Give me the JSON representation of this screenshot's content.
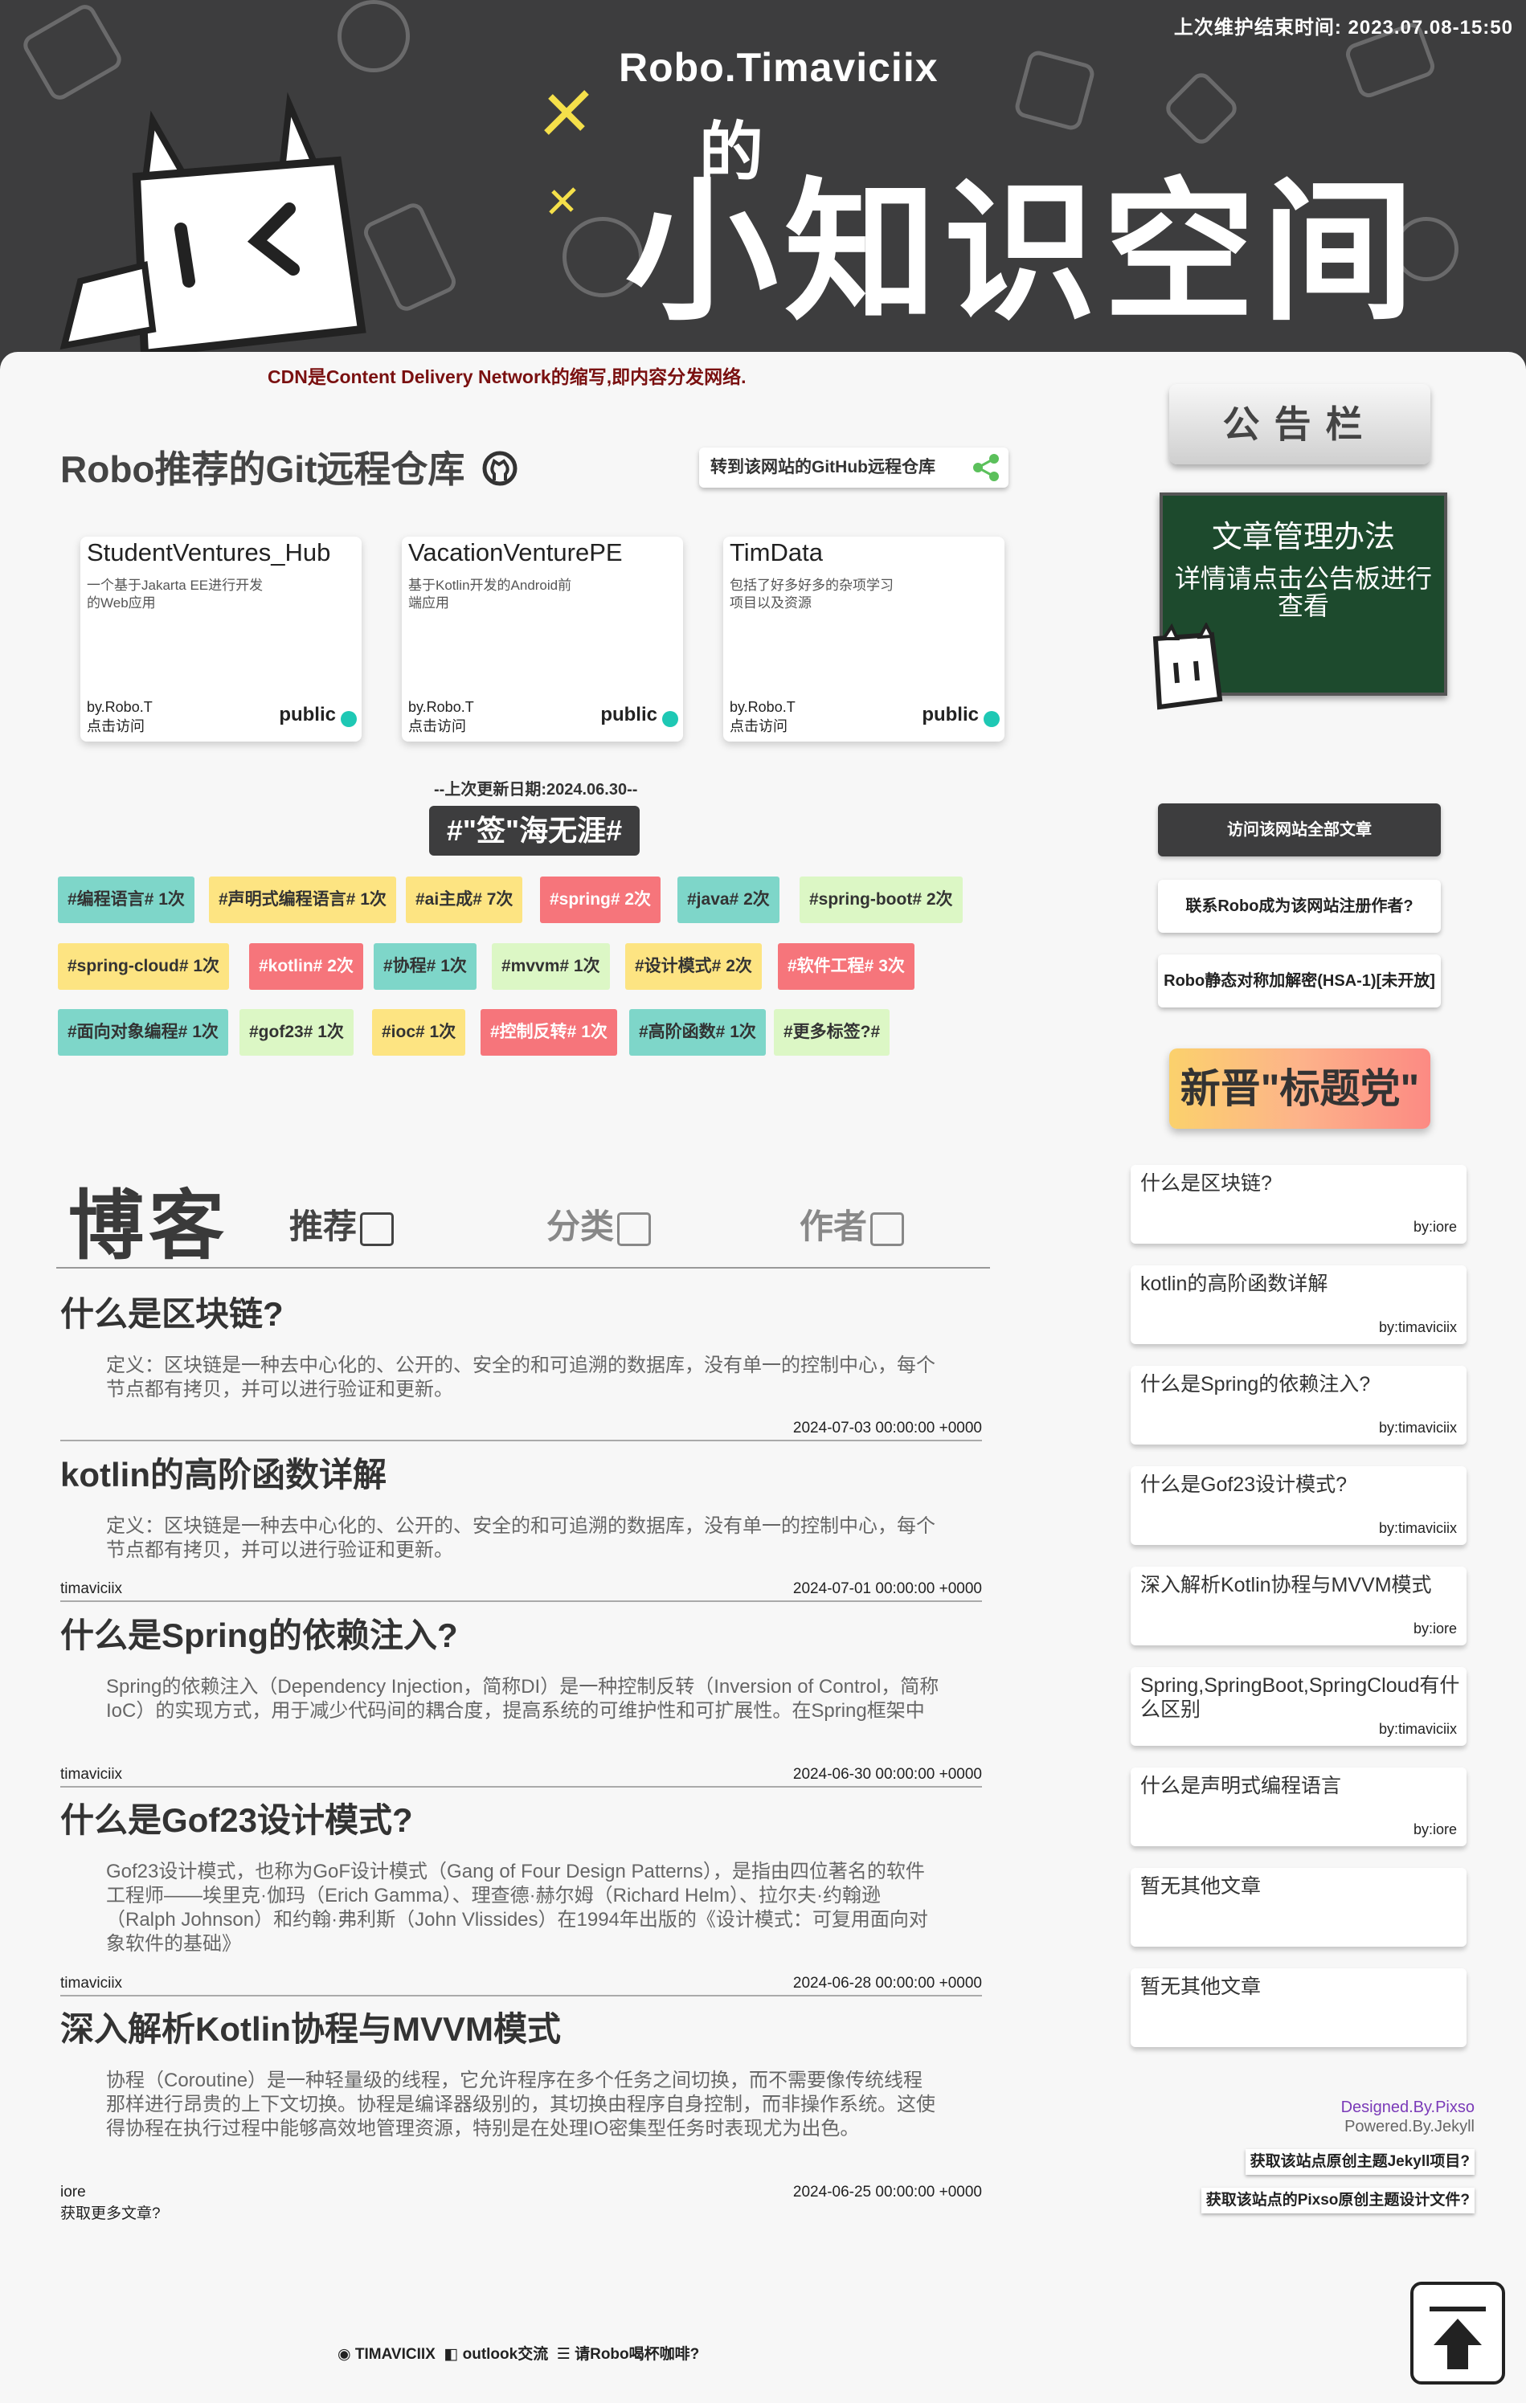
{
  "header": {
    "maintenance": "上次维护结束时间: 2023.07.08-15:50",
    "site_name": "Robo.Timaviciix",
    "site_de": "的",
    "site_title": "小知识空间"
  },
  "cdn_note": "CDN是Content Delivery Network的缩写,即内容分发网络.",
  "repos": {
    "title": "Robo推荐的Git远程仓库",
    "github_link": "转到该网站的GitHub远程仓库",
    "items": [
      {
        "name": "StudentVentures_Hub",
        "desc": "一个基于Jakarta EE进行开发的Web应用",
        "by": "by.Robo.T",
        "visit": "点击访问",
        "vis": "public"
      },
      {
        "name": "VacationVenturePE",
        "desc": "基于Kotlin开发的Android前端应用",
        "by": "by.Robo.T",
        "visit": "点击访问",
        "vis": "public"
      },
      {
        "name": "TimData",
        "desc": "包括了好多好多的杂项学习项目以及资源",
        "by": "by.Robo.T",
        "visit": "点击访问",
        "vis": "public"
      }
    ]
  },
  "tags": {
    "updated": "--上次更新日期:2024.06.30--",
    "title": "#\"签\"海无涯#",
    "items": [
      {
        "label": "#编程语言# 1次",
        "color": "#7ed6c9"
      },
      {
        "label": "#声明式编程语言# 1次",
        "color": "#fde482"
      },
      {
        "label": "#ai主成# 7次",
        "color": "#fde482"
      },
      {
        "label": "#spring# 2次",
        "color": "#f6757b"
      },
      {
        "label": "#java# 2次",
        "color": "#7ed6c9"
      },
      {
        "label": "#spring-boot# 2次",
        "color": "#dcf7c5"
      },
      {
        "label": "#spring-cloud# 1次",
        "color": "#fde482"
      },
      {
        "label": "#kotlin# 2次",
        "color": "#f6757b"
      },
      {
        "label": "#协程# 1次",
        "color": "#7ed6c9"
      },
      {
        "label": "#mvvm# 1次",
        "color": "#dcf7c5"
      },
      {
        "label": "#设计模式# 2次",
        "color": "#fde482"
      },
      {
        "label": "#软件工程# 3次",
        "color": "#f6757b"
      },
      {
        "label": "#面向对象编程# 1次",
        "color": "#7ed6c9"
      },
      {
        "label": "#gof23# 1次",
        "color": "#dcf7c5"
      },
      {
        "label": "#ioc# 1次",
        "color": "#fde482"
      },
      {
        "label": "#控制反转# 1次",
        "color": "#f6757b"
      },
      {
        "label": "#高阶函数# 1次",
        "color": "#7ed6c9"
      },
      {
        "label": "#更多标签?#",
        "color": "#dcf7c5"
      }
    ]
  },
  "blog": {
    "title": "博客",
    "tabs": [
      "推荐",
      "分类",
      "作者"
    ],
    "posts": [
      {
        "title": "什么是区块链?",
        "excerpt": "定义：区块链是一种去中心化的、公开的、安全的和可追溯的数据库，没有单一的控制中心，每个节点都有拷贝，并可以进行验证和更新。",
        "author": "",
        "date": "2024-07-03 00:00:00 +0000"
      },
      {
        "title": "kotlin的高阶函数详解",
        "excerpt": "定义：区块链是一种去中心化的、公开的、安全的和可追溯的数据库，没有单一的控制中心，每个节点都有拷贝，并可以进行验证和更新。",
        "author": "timaviciix",
        "date": "2024-07-01 00:00:00 +0000"
      },
      {
        "title": "什么是Spring的依赖注入?",
        "excerpt": "Spring的依赖注入（Dependency Injection，简称DI）是一种控制反转（Inversion of Control，简称IoC）的实现方式，用于减少代码间的耦合度，提高系统的可维护性和可扩展性。在Spring框架中",
        "author": "timaviciix",
        "date": "2024-06-30 00:00:00 +0000"
      },
      {
        "title": "什么是Gof23设计模式?",
        "excerpt": "Gof23设计模式，也称为GoF设计模式（Gang of Four Design Patterns），是指由四位著名的软件工程师——埃里克·伽玛（Erich Gamma）、理查德·赫尔姆（Richard Helm）、拉尔夫·约翰逊（Ralph Johnson）和约翰·弗利斯（John Vlissides）在1994年出版的《设计模式：可复用面向对象软件的基础》",
        "author": "timaviciix",
        "date": "2024-06-28 00:00:00 +0000"
      },
      {
        "title": "深入解析Kotlin协程与MVVM模式",
        "excerpt": "协程（Coroutine）是一种轻量级的线程，它允许程序在多个任务之间切换，而不需要像传统线程那样进行昂贵的上下文切换。协程是编译器级别的，其切换由程序自身控制，而非操作系统。这使得协程在执行过程中能够高效地管理资源，特别是在处理IO密集型任务时表现尤为出色。",
        "author": "iore",
        "date": "2024-06-25 00:00:00 +0000"
      }
    ],
    "more": "获取更多文章?"
  },
  "sidebar": {
    "board_title": "公告栏",
    "chalk_title": "文章管理办法",
    "chalk_body": "详情请点击公告板进行查看",
    "buttons": [
      "访问该网站全部文章",
      "联系Robo成为该网站注册作者?",
      "Robo静态对称加解密(HSA-1)[未开放]"
    ],
    "new_title": "新晋\"标题党\"",
    "posts": [
      {
        "title": "什么是区块链?",
        "by": "by:iore"
      },
      {
        "title": "kotlin的高阶函数详解",
        "by": "by:timaviciix"
      },
      {
        "title": "什么是Spring的依赖注入?",
        "by": "by:timaviciix"
      },
      {
        "title": "什么是Gof23设计模式?",
        "by": "by:timaviciix"
      },
      {
        "title": "深入解析Kotlin协程与MVVM模式",
        "by": "by:iore"
      },
      {
        "title": "Spring,SpringBoot,SpringCloud有什么区别",
        "by": "by:timaviciix"
      },
      {
        "title": "什么是声明式编程语言",
        "by": "by:iore"
      },
      {
        "title": "暂无其他文章",
        "by": ""
      },
      {
        "title": "暂无其他文章",
        "by": ""
      }
    ],
    "designed": "Designed.By.Pixso",
    "powered": "Powered.By.Jekyll",
    "src_jekyll": "获取该站点原创主题Jekyll项目?",
    "src_pixso": "获取该站点的Pixso原创主题设计文件?"
  },
  "footer": {
    "name": "TIMAVICIIX",
    "outlook": "outlook交流",
    "coffee": "请Robo喝杯咖啡?"
  }
}
